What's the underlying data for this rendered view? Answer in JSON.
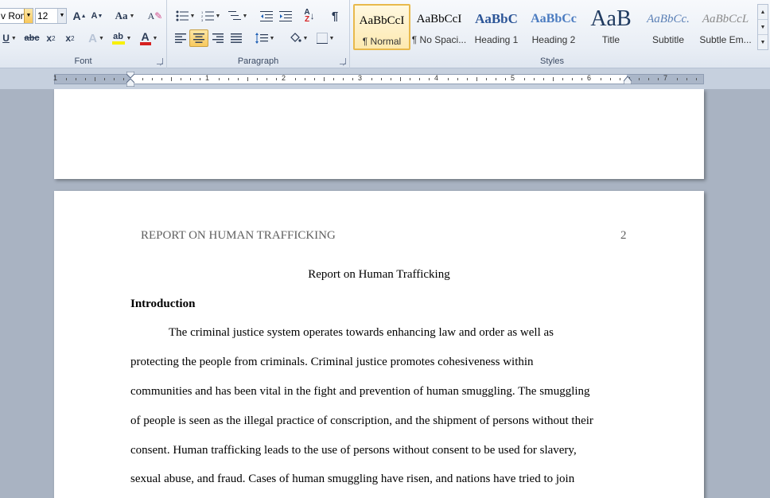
{
  "ribbon": {
    "font_group": {
      "label": "Font",
      "font_name": "v Rom",
      "font_size": "12",
      "grow_label": "A",
      "shrink_label": "A",
      "case_label": "Aa",
      "underline_label": "U",
      "strike_label": "abc",
      "subscript_label": "x",
      "superscript_label": "x",
      "highlight_label": "ab",
      "font_color_label": "A",
      "font_color": "#d62020",
      "highlight_color": "#f8f000"
    },
    "paragraph_group": {
      "label": "Paragraph",
      "sort_label": "A↓Z",
      "show_marks_label": "¶"
    },
    "styles_group": {
      "label": "Styles",
      "items": [
        {
          "sample": "AaBbCcI",
          "name": "¶ Normal"
        },
        {
          "sample": "AaBbCcI",
          "name": "¶ No Spaci..."
        },
        {
          "sample": "AaBbC",
          "name": "Heading 1"
        },
        {
          "sample": "AaBbCc",
          "name": "Heading 2"
        },
        {
          "sample": "AaB",
          "name": "Title"
        },
        {
          "sample": "AaBbCc.",
          "name": "Subtitle"
        },
        {
          "sample": "AaBbCcL",
          "name": "Subtle Em..."
        }
      ]
    }
  },
  "ruler": {
    "numbers": [
      "1",
      "1",
      "2",
      "3",
      "4",
      "5",
      "6",
      "7"
    ]
  },
  "document": {
    "running_head": "REPORT ON HUMAN TRAFFICKING",
    "page_number": "2",
    "title": "Report on Human Trafficking",
    "heading": "Introduction",
    "body_lines": [
      "The criminal justice system operates towards enhancing law and order as well as",
      "protecting the people from criminals.  Criminal justice promotes cohesiveness within",
      "communities and has been vital in the fight and prevention of human smuggling. The smuggling",
      "of people is seen as the illegal practice of conscription, and the shipment of persons without their",
      "consent. Human trafficking leads to the use of persons without consent to be used for slavery,",
      "sexual abuse, and fraud. Cases of human smuggling have risen, and nations have tried to join"
    ]
  }
}
